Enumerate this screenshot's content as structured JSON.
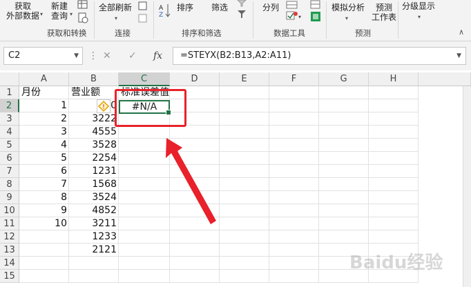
{
  "ribbon": {
    "get_data": [
      "获取",
      "外部数据"
    ],
    "new_query": [
      "新建",
      "查询"
    ],
    "refresh_all": "全部刷新",
    "sort": "排序",
    "filter": "筛选",
    "split_column": "分列",
    "what_if": "模拟分析",
    "forecast": [
      "预测",
      "工作表"
    ],
    "outline": "分级显示",
    "groups": {
      "get_transform": "获取和转换",
      "connections": "连接",
      "sort_filter": "排序和筛选",
      "data_tools": "数据工具",
      "forecast": "预测"
    }
  },
  "formula_bar": {
    "name_box": "C2",
    "cancel": "✕",
    "enter": "✓",
    "fx": "fx",
    "formula": "=STEYX(B2:B13,A2:A11)"
  },
  "sheet": {
    "columns": [
      "A",
      "B",
      "C",
      "D",
      "E",
      "F",
      "G",
      "H"
    ],
    "rows": [
      "1",
      "2",
      "3",
      "4",
      "5",
      "6",
      "7",
      "8",
      "9",
      "10",
      "11",
      "12",
      "13",
      "14",
      "15"
    ],
    "header_a": "月份",
    "header_b": "营业额",
    "header_c": "标准误差值",
    "months": [
      "1",
      "2",
      "3",
      "4",
      "5",
      "6",
      "7",
      "8",
      "9",
      "10"
    ],
    "revenue": [
      "00",
      "3222",
      "4555",
      "3528",
      "2254",
      "1231",
      "1568",
      "3524",
      "4852",
      "3211",
      "1233",
      "2121"
    ],
    "c2_value": "#N/A"
  },
  "colors": {
    "accent": "#217346",
    "highlight": "#e8212a"
  },
  "watermark": "Baidu经验"
}
